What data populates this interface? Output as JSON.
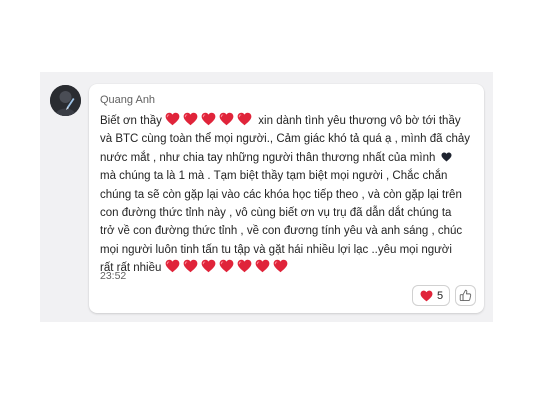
{
  "message": {
    "sender": "Quang Anh",
    "line1_prefix": "Biết ơn thầy",
    "line1_suffix": "xin dành tình yêu thương vô bờ tới thầy",
    "line2": "và BTC cùng toàn thể mọi người., Cảm giác khó tả quá ạ , mình đã chảy",
    "line3": "nước mắt , như chia tay những người thân thương nhất của mình",
    "line4": "mà chúng ta là 1 mà . Tạm biệt thầy tạm biệt mọi người , Chắc chắn",
    "line5": "chúng ta sẽ còn gặp lại vào các khóa học tiếp theo , và còn gặp lại trên",
    "line6": "con đường thức tỉnh này , vô cùng biết ơn vụ trụ đã dẫn dắt chúng ta",
    "line7": "trở về con đường thức tỉnh , về con đương tính yêu và anh sáng , chúc",
    "line8": "mọi người luôn tinh tấn tu tập và gặt hái nhiều lợi lạc ..yêu mọi người",
    "line9_prefix": "rất rất nhiều",
    "line1_heart_count": 5,
    "line9_heart_count": 7,
    "timestamp": "23:52"
  },
  "reactions": {
    "heart_count": "5",
    "heart_icon": "red-heart-icon",
    "like_icon": "thumbs-up-icon"
  },
  "colors": {
    "heart_red": "#e0243a",
    "dark_heart": "#1f2430",
    "panel_bg": "#f1f1f3"
  }
}
